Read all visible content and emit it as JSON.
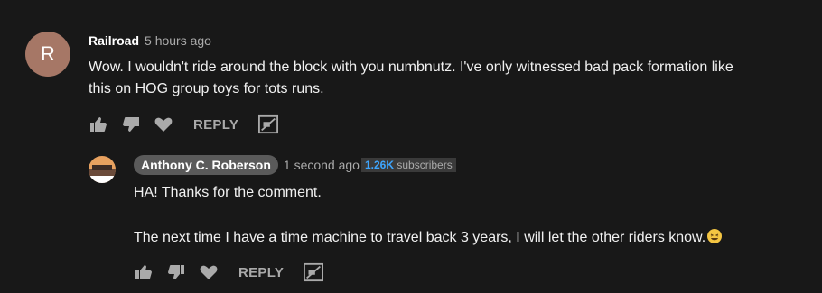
{
  "comments": [
    {
      "author": "Railroad",
      "time": "5 hours ago",
      "avatar_letter": "R",
      "avatar_color": "#a67766",
      "text_line1": "Wow. I wouldn't ride around the block with you numbnutz. I've only witnessed bad pack formation like",
      "text_line2": "this on HOG group toys for tots runs.",
      "reply_label": "REPLY",
      "icons": [
        "thumb-up-icon",
        "thumb-down-icon",
        "heart-icon",
        "promote-icon"
      ]
    },
    {
      "author": "Anthony C. Roberson",
      "time": "1 second ago",
      "subscriber_count": "1.26K",
      "subscriber_label": "subscribers",
      "text_line1": "HA! Thanks for the comment.",
      "text_line2": "The next time I have a time machine to travel back 3 years, I will let the other riders know.",
      "emoji": "grinning-squint-emoji",
      "reply_label": "REPLY",
      "icons": [
        "thumb-up-icon",
        "thumb-down-icon",
        "heart-icon",
        "promote-icon"
      ]
    }
  ],
  "colors": {
    "background": "#181818",
    "text": "#f1f1f1",
    "secondary": "#aaaaaa",
    "link": "#3ea6ff"
  }
}
